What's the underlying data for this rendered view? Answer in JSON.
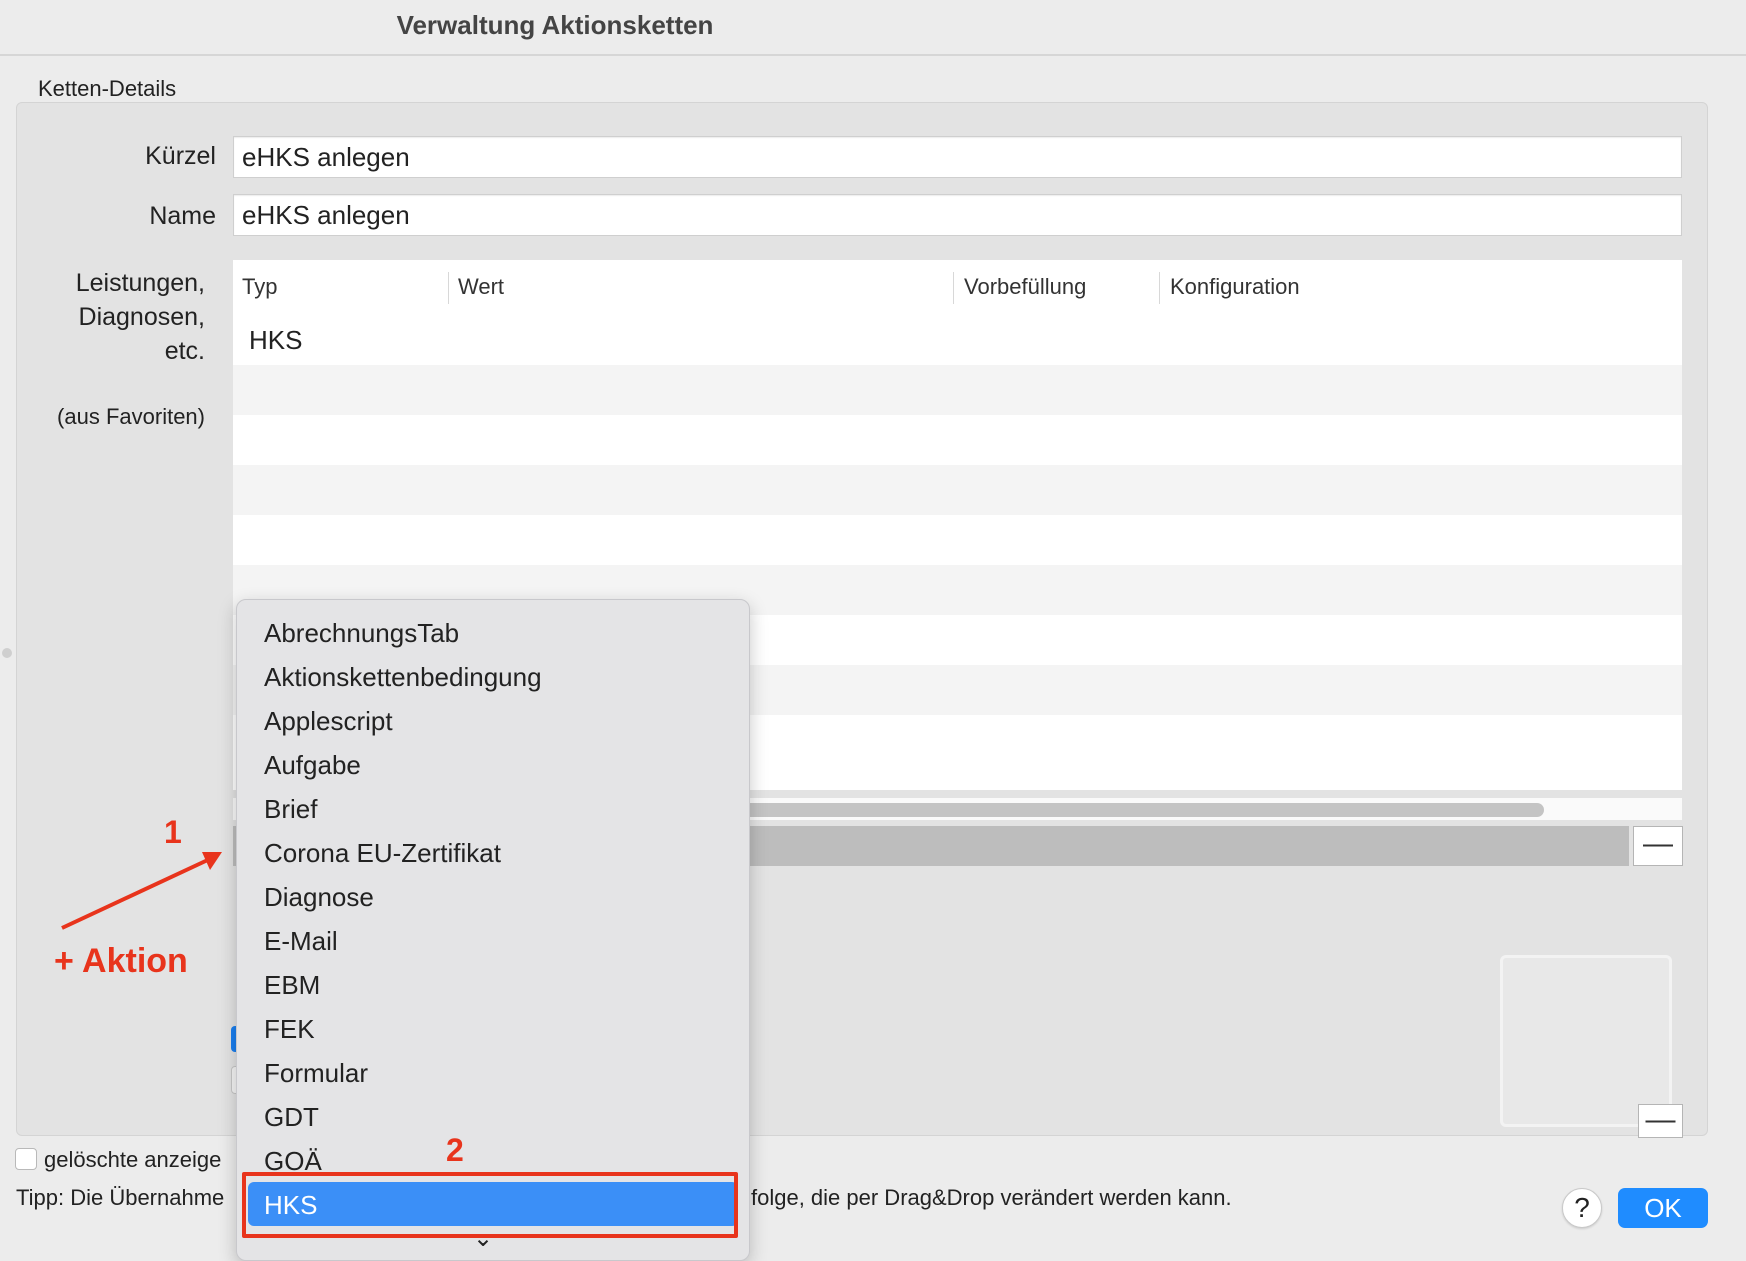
{
  "window": {
    "title": "Verwaltung Aktionsketten"
  },
  "details": {
    "section_label": "Ketten-Details",
    "kuerzel_label": "Kürzel",
    "kuerzel_value": "eHKS anlegen",
    "name_label": "Name",
    "name_value": "eHKS anlegen",
    "services_label_line1": "Leistungen,",
    "services_label_line2": "Diagnosen,",
    "services_label_line3": "etc.",
    "favorites_note": "(aus Favoriten)"
  },
  "table": {
    "columns": [
      "Typ",
      "Wert",
      "Vorbefüllung",
      "Konfiguration"
    ],
    "rows": [
      {
        "typ": "HKS",
        "wert": "",
        "vorbefuellung": "",
        "konfiguration": ""
      }
    ]
  },
  "controls": {
    "minus_symbol": "—"
  },
  "footer": {
    "checkbox_label": "gelöschte anzeige",
    "tip_left": "Tipp: Die Übernahme",
    "tip_right": "folge, die per Drag&Drop verändert werden kann.",
    "help_label": "?",
    "ok_label": "OK"
  },
  "dropdown": {
    "items": [
      "AbrechnungsTab",
      "Aktionskettenbedingung",
      "Applescript",
      "Aufgabe",
      "Brief",
      "Corona EU-Zertifikat",
      "Diagnose",
      "E-Mail",
      "EBM",
      "FEK",
      "Formular",
      "GDT",
      "GOÄ",
      "HKS"
    ],
    "selected": "HKS",
    "more_indicator": "⌄"
  },
  "annotations": {
    "step1": "1",
    "step1_caption": "+ Aktion",
    "step2": "2",
    "color": "#e8341c"
  },
  "colors": {
    "accent": "#1f8cff",
    "menu_highlight": "#3b8ff7"
  }
}
